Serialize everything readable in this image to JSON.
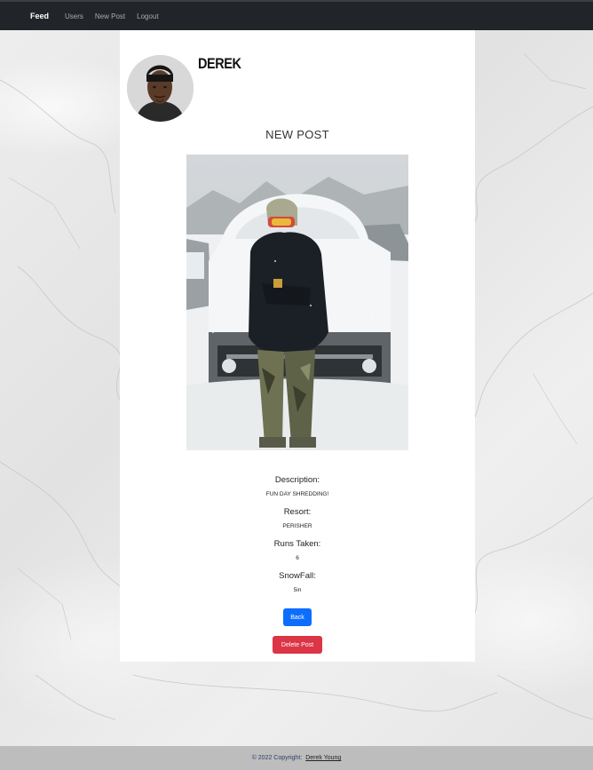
{
  "navbar": {
    "brand": "Feed",
    "links": [
      "Users",
      "New Post",
      "Logout"
    ]
  },
  "profile": {
    "username": "DEREK"
  },
  "post": {
    "heading": "NEW POST",
    "fields": [
      {
        "label": "Description:",
        "value": "FUN DAY SHREDDING!"
      },
      {
        "label": "Resort:",
        "value": "PERISHER"
      },
      {
        "label": "Runs Taken:",
        "value": "6"
      },
      {
        "label": "SnowFall:",
        "value": "5in"
      }
    ],
    "back_label": "Back",
    "delete_label": "Delete Post"
  },
  "footer": {
    "copyright": "© 2022 Copyright:",
    "owner": "Derek Young"
  }
}
